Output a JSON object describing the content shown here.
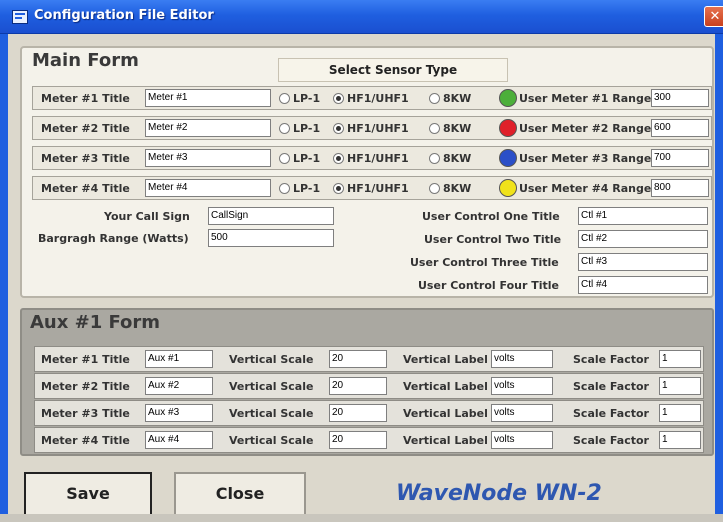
{
  "window": {
    "title": "Configuration File Editor",
    "close_glyph": "✕"
  },
  "main_form": {
    "title": "Main Form",
    "sensor_header": "Select Sensor Type",
    "sensor_options": [
      "LP-1",
      "HF1/UHF1",
      "8KW"
    ],
    "meters": [
      {
        "label": "Meter #1 Title",
        "value": "Meter #1",
        "selected_sensor": "HF1/UHF1",
        "led_color": "#4caf3a",
        "range_label": "User Meter #1 Range",
        "range_value": "300"
      },
      {
        "label": "Meter #2 Title",
        "value": "Meter #2",
        "selected_sensor": "HF1/UHF1",
        "led_color": "#e0202a",
        "range_label": "User Meter #2 Range",
        "range_value": "600"
      },
      {
        "label": "Meter #3 Title",
        "value": "Meter #3",
        "selected_sensor": "HF1/UHF1",
        "led_color": "#2b4fc8",
        "range_label": "User Meter #3 Range",
        "range_value": "700"
      },
      {
        "label": "Meter #4 Title",
        "value": "Meter #4",
        "selected_sensor": "HF1/UHF1",
        "led_color": "#f0e21a",
        "range_label": "User Meter #4 Range",
        "range_value": "800"
      }
    ],
    "call_sign_label": "Your Call Sign",
    "call_sign_value": "CallSign",
    "bargraph_label": "Bargragh Range (Watts)",
    "bargraph_value": "500",
    "user_controls": [
      {
        "label": "User Control One Title",
        "value": "Ctl #1"
      },
      {
        "label": "User Control Two Title",
        "value": "Ctl #2"
      },
      {
        "label": "User Control Three Title",
        "value": "Ctl #3"
      },
      {
        "label": "User Control Four Title",
        "value": "Ctl #4"
      }
    ]
  },
  "aux_form": {
    "title": "Aux #1 Form",
    "rows": [
      {
        "meter_label": "Meter #1 Title",
        "meter_value": "Aux #1",
        "vscale_label": "Vertical Scale",
        "vscale_value": "20",
        "vlabel_label": "Vertical Label",
        "vlabel_value": "volts",
        "scale_label": "Scale Factor",
        "scale_value": "1"
      },
      {
        "meter_label": "Meter #2 Title",
        "meter_value": "Aux #2",
        "vscale_label": "Vertical Scale",
        "vscale_value": "20",
        "vlabel_label": "Vertical Label",
        "vlabel_value": "volts",
        "scale_label": "Scale Factor",
        "scale_value": "1"
      },
      {
        "meter_label": "Meter #3 Title",
        "meter_value": "Aux #3",
        "vscale_label": "Vertical Scale",
        "vscale_value": "20",
        "vlabel_label": "Vertical Label",
        "vlabel_value": "volts",
        "scale_label": "Scale Factor",
        "scale_value": "1"
      },
      {
        "meter_label": "Meter #4 Title",
        "meter_value": "Aux #4",
        "vscale_label": "Vertical Scale",
        "vscale_value": "20",
        "vlabel_label": "Vertical Label",
        "vlabel_value": "volts",
        "scale_label": "Scale Factor",
        "scale_value": "1"
      }
    ]
  },
  "buttons": {
    "save": "Save",
    "close": "Close"
  },
  "brand": "WaveNode  WN-2"
}
